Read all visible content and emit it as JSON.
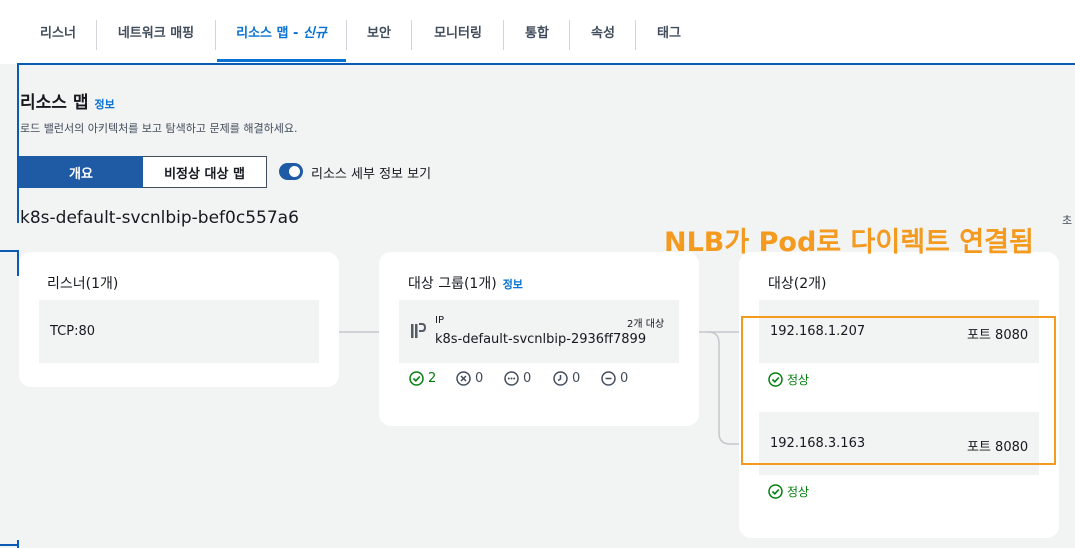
{
  "tabs": [
    {
      "label": "리스너"
    },
    {
      "label": "네트워크 매핑"
    },
    {
      "label": "리소스 맵 - ",
      "label_suffix": "신규"
    },
    {
      "label": "보안"
    },
    {
      "label": "모니터링"
    },
    {
      "label": "통합"
    },
    {
      "label": "속성"
    },
    {
      "label": "태그"
    }
  ],
  "header": {
    "title": "리소스 맵",
    "info": "정보",
    "subtitle": "로드 밸런서의 아키텍처를 보고 탐색하고 문제를 해결하세요."
  },
  "view": {
    "overview": "개요",
    "unhealthy_map": "비정상 대상 맵",
    "toggle_label": "리소스 세부 정보 보기"
  },
  "load_balancer": {
    "name": "k8s-default-svcnlbip-bef0c557a6",
    "cut_text": "초"
  },
  "annotation": "NLB가 Pod로 다이렉트 연결됨",
  "listeners": {
    "title": "리스너(1개)",
    "items": [
      {
        "label": "TCP:80"
      }
    ]
  },
  "target_group": {
    "title": "대상 그룹(1개)",
    "info": "정보",
    "type": "IP",
    "name": "k8s-default-svcnlbip-2936ff7899",
    "count": "2개 대상",
    "stats": {
      "healthy": "2",
      "unhealthy": "0",
      "unused": "0",
      "initial": "0",
      "draining": "0"
    }
  },
  "targets": {
    "title": "대상(2개)",
    "items": [
      {
        "ip": "192.168.1.207",
        "port": "포트 8080",
        "status": "정상"
      },
      {
        "ip": "192.168.3.163",
        "port": "포트 8080",
        "status": "정상"
      }
    ]
  },
  "colors": {
    "accent": "#0972d3",
    "healthy": "#037f0c",
    "annotation": "#f39a1f"
  }
}
